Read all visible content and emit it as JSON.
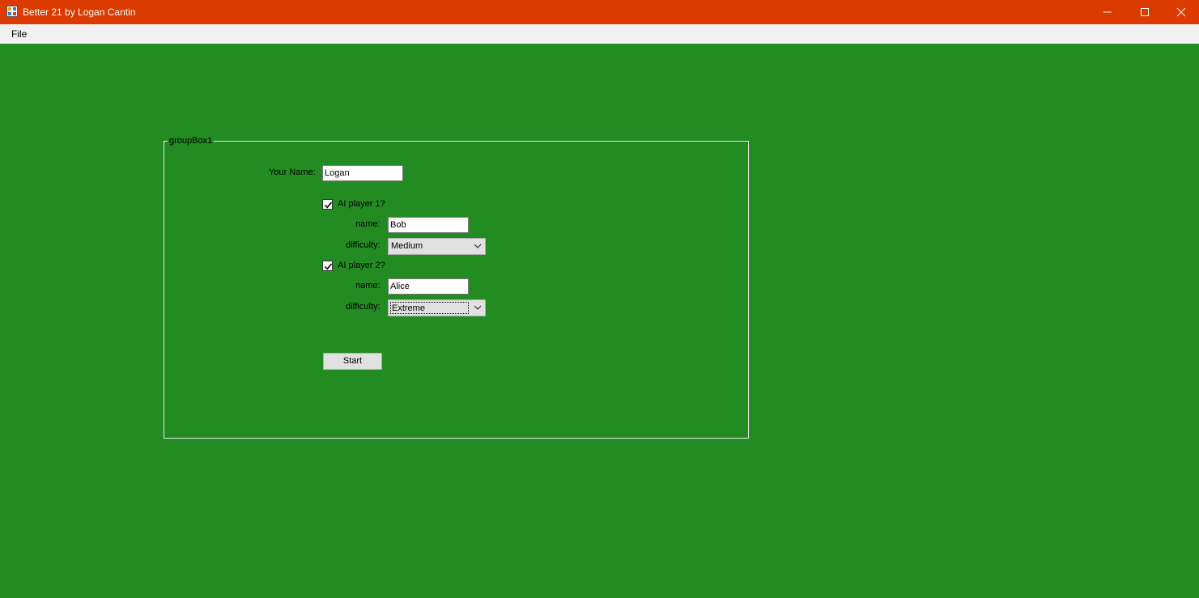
{
  "window": {
    "title": "Better 21 by Logan Cantin",
    "icon": "app-icon",
    "controls": [
      "minimize-icon",
      "maximize-icon",
      "close-icon"
    ],
    "titlebar_color": "#dc3b00"
  },
  "menu": {
    "file_label": "File"
  },
  "client": {
    "background_color": "#228b22"
  },
  "groupbox": {
    "title": "groupBox1"
  },
  "form": {
    "your_name_label": "Your Name:",
    "your_name_value": "Logan",
    "ai1": {
      "checkbox_label": "AI player 1?",
      "checked": true,
      "name_label": "name:",
      "name_value": "Bob",
      "difficulty_label": "difficulty:",
      "difficulty_value": "Medium"
    },
    "ai2": {
      "checkbox_label": "AI player 2?",
      "checked": true,
      "name_label": "name:",
      "name_value": "Alice",
      "difficulty_label": "difficulty:",
      "difficulty_value": "Extreme"
    },
    "start_label": "Start"
  }
}
